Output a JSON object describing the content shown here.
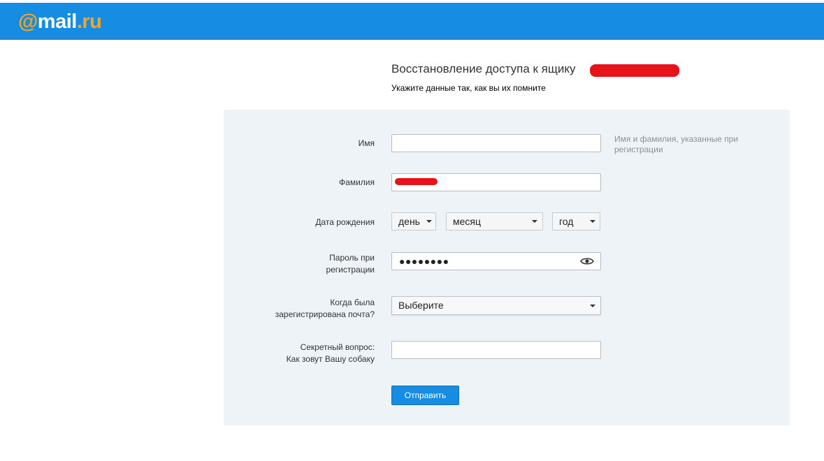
{
  "header": {
    "logo_at": "@",
    "logo_mail": "mail",
    "logo_dot": ".",
    "logo_ru": "ru",
    "brand_color": "#168de2"
  },
  "page": {
    "title": "Восстановление доступа к ящику",
    "subtitle": "Укажите данные так, как вы их помните"
  },
  "form": {
    "first_name": {
      "label": "Имя",
      "value": "",
      "hint": "Имя и фамилия, указанные при регистрации"
    },
    "last_name": {
      "label": "Фамилия",
      "value": ""
    },
    "birth_date": {
      "label": "Дата рождения",
      "day": "день",
      "month": "месяц",
      "year": "год"
    },
    "password": {
      "label_line1": "Пароль при",
      "label_line2": "регистрации",
      "masked_value": "●●●●●●●●",
      "toggle_icon": "eye-icon"
    },
    "registered_when": {
      "label_line1": "Когда была",
      "label_line2": "зарегистрирована почта?",
      "selected": "Выберите"
    },
    "secret_question": {
      "label_line1": "Секретный вопрос:",
      "label_line2": "Как зовут Вашу собаку",
      "value": ""
    },
    "submit_label": "Отправить"
  }
}
